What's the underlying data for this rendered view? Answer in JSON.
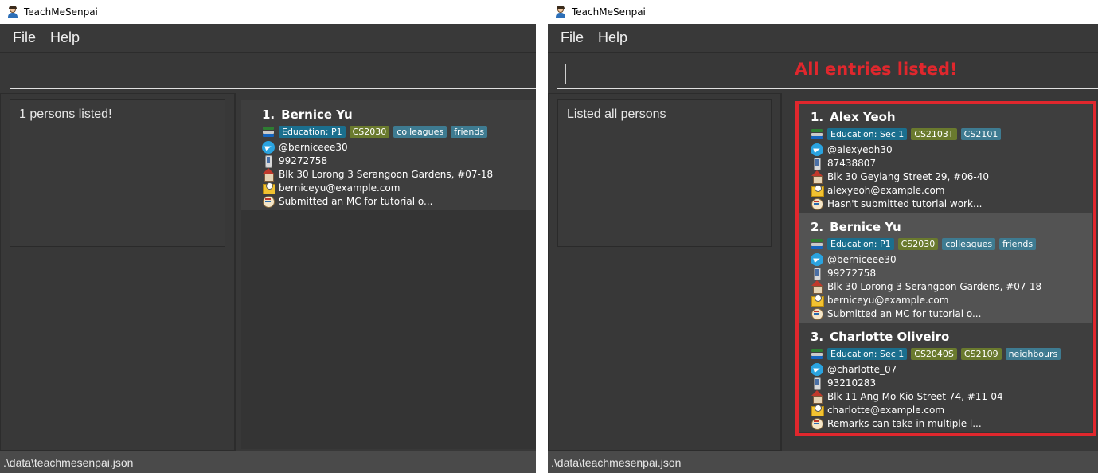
{
  "app_title": "TeachMeSenpai",
  "menu": [
    "File",
    "Help"
  ],
  "status_path": ".\\data\\teachmesenpai.json",
  "colors": {
    "tag_education": "#1b6f8e",
    "tag_module": "#6a7a2e",
    "tag_group": "#3e7b91",
    "highlight": "#e0272d"
  },
  "left": {
    "result": "1 persons listed!",
    "persons": [
      {
        "index": "1.",
        "name": "Bernice Yu",
        "education": "Education: P1",
        "modules": [
          "CS2030"
        ],
        "tags": [
          "colleagues",
          "friends"
        ],
        "telegram": "@berniceee30",
        "phone": "99272758",
        "address": "Blk 30 Lorong 3 Serangoon Gardens, #07-18",
        "email": "berniceyu@example.com",
        "remark": "Submitted an MC for tutorial o..."
      }
    ]
  },
  "right": {
    "annotation": "All entries listed!",
    "result": "Listed all persons",
    "persons": [
      {
        "index": "1.",
        "name": "Alex Yeoh",
        "education": "Education: Sec 1",
        "modules": [
          "CS2103T",
          "CS2101"
        ],
        "tags": [],
        "telegram": "@alexyeoh30",
        "phone": "87438807",
        "address": "Blk 30 Geylang Street 29, #06-40",
        "email": "alexyeoh@example.com",
        "remark": "Hasn't submitted tutorial work..."
      },
      {
        "index": "2.",
        "name": "Bernice Yu",
        "education": "Education: P1",
        "modules": [
          "CS2030"
        ],
        "tags": [
          "colleagues",
          "friends"
        ],
        "telegram": "@berniceee30",
        "phone": "99272758",
        "address": "Blk 30 Lorong 3 Serangoon Gardens, #07-18",
        "email": "berniceyu@example.com",
        "remark": "Submitted an MC for tutorial o..."
      },
      {
        "index": "3.",
        "name": "Charlotte Oliveiro",
        "education": "Education: Sec 1",
        "modules": [
          "CS2040S",
          "CS2109"
        ],
        "tags": [
          "neighbours"
        ],
        "telegram": "@charlotte_07",
        "phone": "93210283",
        "address": "Blk 11 Ang Mo Kio Street 74, #11-04",
        "email": "charlotte@example.com",
        "remark": "Remarks can take in multiple l..."
      }
    ]
  }
}
